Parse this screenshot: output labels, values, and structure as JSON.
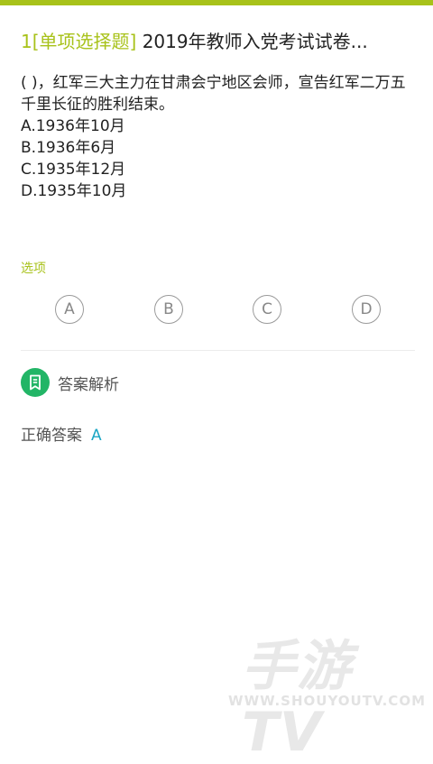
{
  "header": {
    "accent_color": "#a8c21a",
    "number_type": "1[单项选择题]",
    "exam_title": " 2019年教师入党考试试卷..."
  },
  "question": {
    "stem": "( )，红军三大主力在甘肃会宁地区会师，宣告红军二万五千里长征的胜利结束。",
    "options": [
      "A.1936年10月",
      "B.1936年6月",
      "C.1935年12月",
      "D.1935年10月"
    ]
  },
  "options_section": {
    "label": "选项",
    "choices": [
      "A",
      "B",
      "C",
      "D"
    ]
  },
  "analysis": {
    "icon": "bookmark-icon",
    "icon_color": "#22b566",
    "label": "答案解析"
  },
  "answer": {
    "label": "正确答案",
    "value": "A",
    "value_color": "#1aa6c4"
  },
  "watermark": {
    "logo_text": "手游TV",
    "url": "WWW.SHOUYOUTV.COM"
  }
}
